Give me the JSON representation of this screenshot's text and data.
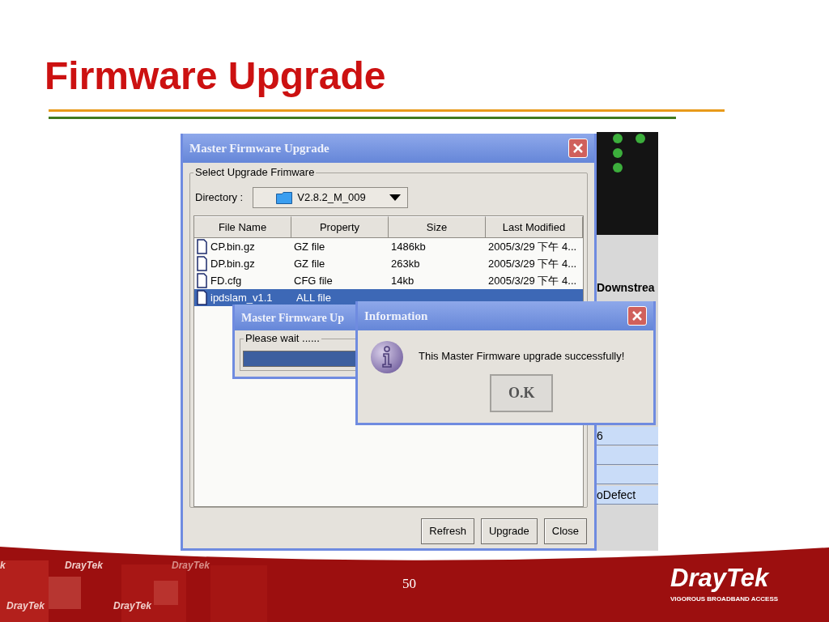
{
  "slide": {
    "title": "Firmware Upgrade",
    "page_number": "50",
    "logo": {
      "name": "DrayTek",
      "tagline": "VIGOROUS BROADBAND ACCESS"
    },
    "pattern_labels": [
      "k",
      "DrayTek",
      "DrayTek",
      "DrayTek",
      "DrayTek"
    ]
  },
  "background_app": {
    "header": "Downstrea",
    "cells": [
      "6",
      "oDefect"
    ]
  },
  "main_window": {
    "title": "Master Firmware Upgrade",
    "group_label": "Select Upgrade Frimware",
    "directory": {
      "label": "Directory :",
      "value": "V2.8.2_M_009"
    },
    "table": {
      "columns": [
        "File Name",
        "Property",
        "Size",
        "Last Modified"
      ],
      "rows": [
        {
          "cells": [
            "CP.bin.gz",
            "GZ file",
            "1486kb",
            "2005/3/29 下午 4..."
          ],
          "selected": false
        },
        {
          "cells": [
            "DP.bin.gz",
            "GZ file",
            "263kb",
            "2005/3/29 下午 4..."
          ],
          "selected": false
        },
        {
          "cells": [
            "FD.cfg",
            "CFG file",
            "14kb",
            "2005/3/29 下午 4..."
          ],
          "selected": false
        },
        {
          "cells": [
            "ipdslam_v1.1",
            "ALL file"
          ],
          "selected": true
        }
      ]
    },
    "buttons": [
      "Refresh",
      "Upgrade",
      "Close"
    ]
  },
  "progress_dialog": {
    "title": "Master Firmware Up",
    "group_label": "Please wait ......",
    "level": 1
  },
  "info_dialog": {
    "title": "Information",
    "message": "This Master Firmware upgrade successfully!",
    "button": "O.K"
  }
}
